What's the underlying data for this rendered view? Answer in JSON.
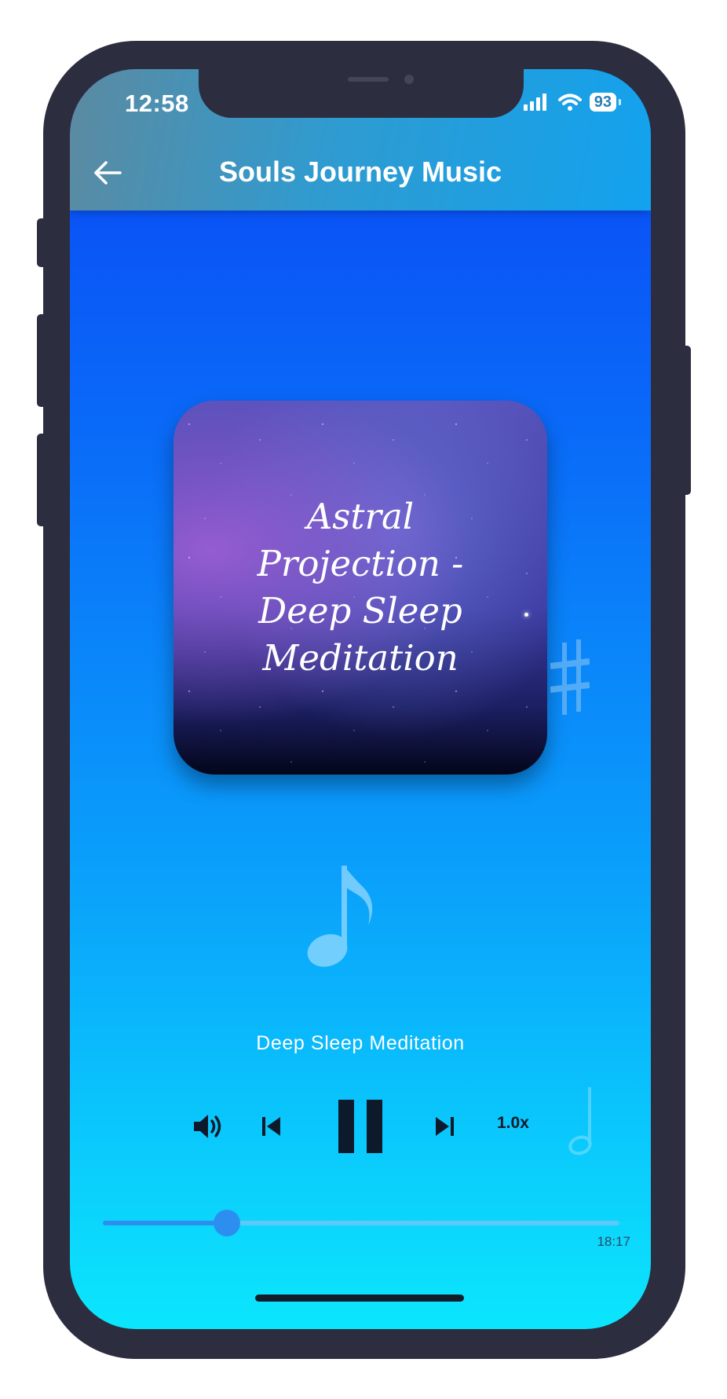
{
  "status_bar": {
    "time": "12:58",
    "battery": "93",
    "icons": [
      "signal-icon",
      "wifi-icon",
      "battery-icon"
    ]
  },
  "header": {
    "title": "Souls Journey Music",
    "back_icon": "arrow-left-icon"
  },
  "album": {
    "title": "Astral\nProjection -\nDeep Sleep\nMeditation"
  },
  "track": {
    "name": "Deep Sleep Meditation"
  },
  "controls": {
    "volume_icon": "volume-icon",
    "previous_icon": "skip-previous-icon",
    "pause_icon": "pause-icon",
    "next_icon": "skip-next-icon",
    "speed": "1.0x"
  },
  "progress": {
    "fraction": 0.24,
    "duration": "18:17"
  },
  "colors": {
    "accent": "#2c8ff0",
    "track": "#5cc9f9",
    "frame": "#2d2d40"
  }
}
